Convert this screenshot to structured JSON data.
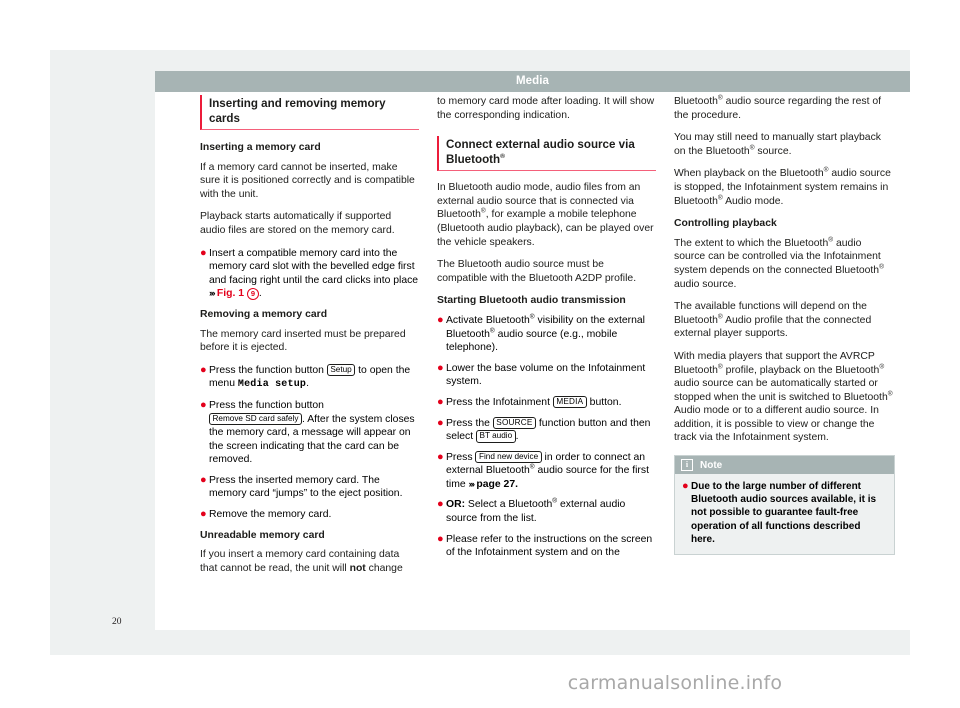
{
  "document": {
    "chapter_title": "Media",
    "page_number": "20",
    "watermark": "carmanualsonline.info"
  },
  "colors": {
    "accent_red": "#e3001b",
    "heading_rule": "#f4607a",
    "bar_gray": "#a7b4b4",
    "panel_gray": "#eef1f1"
  },
  "column1": {
    "heading": "Inserting and removing memory cards",
    "sub1": "Inserting a memory card",
    "p1": "If a memory card cannot be inserted, make sure it is positioned correctly and is compatible with the unit.",
    "p2": "Playback starts automatically if supported audio files are stored on the memory card.",
    "b1_a": "Insert a compatible memory card into the memory card slot with the bevelled edge first and facing right until the card clicks into place ",
    "b1_ref": "Fig. 1",
    "b1_circle": "9",
    "b1_end": ".",
    "sub2": "Removing a memory card",
    "p3": "The memory card inserted must be prepared before it is ejected.",
    "b2_a": "Press the function button ",
    "b2_btn": "Setup",
    "b2_b": " to open the menu ",
    "b2_mono": "Media setup",
    "b2_c": ".",
    "b3_a": "Press the function button ",
    "b3_btn": "Remove SD card safely",
    "b3_b": ". After the system closes the memory card, a message will appear on the screen indicating that the card can be removed.",
    "b4": "Press the inserted memory card. The memory card “jumps” to the eject position.",
    "b5": "Remove the memory card.",
    "sub3": "Unreadable memory card",
    "p4_a": "If you insert a memory card containing data that cannot be read, the unit will ",
    "p4_bold": "not",
    "p4_b": " change"
  },
  "column2": {
    "p1": "to memory card mode after loading. It will show the corresponding indication.",
    "heading_a": "Connect external audio source via Bluetooth",
    "heading_sup": "®",
    "p2_a": "In Bluetooth audio mode, audio files from an external audio source that is connected via Bluetooth",
    "p2_b": ", for example a mobile telephone (Bluetooth audio playback), can be played over the vehicle speakers.",
    "p3": "The Bluetooth audio source must be compatible with the Bluetooth A2DP profile.",
    "sub1": "Starting Bluetooth audio transmission",
    "b1_a": "Activate Bluetooth",
    "b1_b": " visibility on the external Bluetooth",
    "b1_c": " audio source (e.g., mobile telephone).",
    "b2": "Lower the base volume on the Infotainment system.",
    "b3_a": "Press the Infotainment ",
    "b3_btn": "MEDIA",
    "b3_b": " button.",
    "b4_a": "Press the ",
    "b4_btn1": "SOURCE",
    "b4_b": " function button and then select ",
    "b4_btn2": "BT audio",
    "b4_c": ".",
    "b5_a": "Press ",
    "b5_btn": "Find new device",
    "b5_b": " in order to connect an external Bluetooth",
    "b5_c": " audio source for the first time ",
    "b5_ref": "page 27.",
    "b6_bold": "OR:",
    "b6_a": " Select a Bluetooth",
    "b6_b": " external audio source from the list.",
    "b7": "Please refer to the instructions on the screen of the Infotainment system and on the"
  },
  "column3": {
    "p1_a": "Bluetooth",
    "p1_b": " audio source regarding the rest of the procedure.",
    "p2_a": "You may still need to manually start playback on the Bluetooth",
    "p2_b": " source.",
    "p3_a": "When playback on the Bluetooth",
    "p3_b": " audio source is stopped, the Infotainment system remains in Bluetooth",
    "p3_c": " Audio mode.",
    "sub1": "Controlling playback",
    "p4_a": "The extent to which the Bluetooth",
    "p4_b": " audio source can be controlled via the Infotainment system depends on the connected Bluetooth",
    "p4_c": " audio source.",
    "p5_a": "The available functions will depend on the Bluetooth",
    "p5_b": " Audio profile that the connected external player supports.",
    "p6_a": "With media players that support the AVRCP Bluetooth",
    "p6_b": " profile, playback on the Bluetooth",
    "p6_c": " audio source can be automatically started or stopped when the unit is switched to Bluetooth",
    "p6_d": " Audio mode or to a different audio source. In addition, it is possible to view or change the track via the Infotainment system.",
    "note": {
      "icon": "i",
      "title": "Note",
      "text": "Due to the large number of different Bluetooth audio sources available, it is not possible to guarantee fault-free operation of all functions described here."
    }
  }
}
